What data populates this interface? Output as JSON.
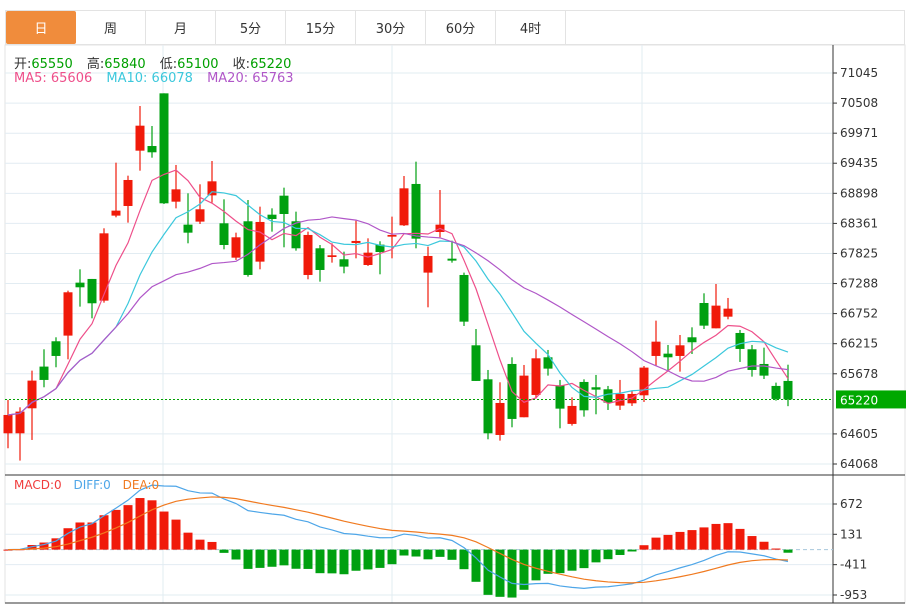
{
  "tabs": [
    "日",
    "周",
    "月",
    "5分",
    "15分",
    "30分",
    "60分",
    "4时"
  ],
  "active_tab": 0,
  "info": {
    "open_label": "开:",
    "open": "65550",
    "high_label": "高:",
    "high": "65840",
    "low_label": "低:",
    "low": "65100",
    "close_label": "收:",
    "close": "65220"
  },
  "ma": {
    "ma5": "MA5: 65606",
    "ma10": "MA10: 66078",
    "ma20": "MA20: 65763"
  },
  "macd": {
    "macd": "MACD:0",
    "diff": "DIFF:0",
    "dea": "DEA:0"
  },
  "colors": {
    "up": "#f01a0a",
    "down": "#00a010",
    "ma5": "#ee4f8a",
    "ma10": "#3cc8dc",
    "ma20": "#b057c8",
    "diff": "#4ea6e8",
    "dea": "#f07a20",
    "active_tab": "#F08C3C"
  },
  "chart_data": {
    "type": "candlestick",
    "price_ticks": [
      "71045",
      "70508",
      "69971",
      "69435",
      "68898",
      "68361",
      "67825",
      "67288",
      "66752",
      "66215",
      "65678",
      "64605",
      "64068"
    ],
    "price_range": [
      64068,
      71045
    ],
    "last_price": "65220",
    "macd_ticks": [
      "672",
      "131",
      "-411",
      "-953"
    ],
    "macd_range": [
      -953,
      672
    ],
    "ohlc": [
      [
        64616,
        65211,
        64349,
        64943
      ],
      [
        64616,
        65080,
        64129,
        65003
      ],
      [
        65062,
        65734,
        64497,
        65556
      ],
      [
        65806,
        66115,
        65437,
        65568
      ],
      [
        66258,
        66329,
        65794,
        65996
      ],
      [
        66359,
        67161,
        65936,
        67132
      ],
      [
        67304,
        67542,
        66876,
        67221
      ],
      [
        67370,
        67370,
        66668,
        66936
      ],
      [
        66983,
        68274,
        66947,
        68184
      ],
      [
        68500,
        69445,
        68470,
        68589
      ],
      [
        68672,
        69213,
        68375,
        69136
      ],
      [
        69659,
        70456,
        69302,
        70105
      ],
      [
        69742,
        70099,
        69534,
        69630
      ],
      [
        70682,
        70682,
        68708,
        68720
      ],
      [
        68749,
        69404,
        68630,
        68969
      ],
      [
        68339,
        68898,
        68006,
        68196
      ],
      [
        68393,
        69059,
        68351,
        68613
      ],
      [
        68862,
        69475,
        68732,
        69112
      ],
      [
        68363,
        68791,
        67899,
        67976
      ],
      [
        67750,
        68196,
        67709,
        68113
      ],
      [
        68399,
        68779,
        67411,
        67441
      ],
      [
        67679,
        68660,
        67542,
        68387
      ],
      [
        68517,
        68630,
        68214,
        68440
      ],
      [
        68856,
        68999,
        67935,
        68529
      ],
      [
        68399,
        68571,
        67875,
        67917
      ],
      [
        67441,
        68214,
        67364,
        68155
      ],
      [
        67917,
        67976,
        67322,
        67530
      ],
      [
        67762,
        68006,
        67661,
        67792
      ],
      [
        67721,
        67857,
        67471,
        67590
      ],
      [
        68012,
        68410,
        67738,
        68048
      ],
      [
        67619,
        68095,
        67602,
        67839
      ],
      [
        67982,
        68042,
        67453,
        67851
      ],
      [
        68125,
        68482,
        67738,
        68155
      ],
      [
        68327,
        69207,
        68315,
        68987
      ],
      [
        69065,
        69463,
        67917,
        68089
      ],
      [
        67483,
        67946,
        66864,
        67780
      ],
      [
        68208,
        68957,
        68113,
        68339
      ],
      [
        67732,
        68053,
        67661,
        67697
      ],
      [
        67441,
        67483,
        66531,
        66608
      ],
      [
        66186,
        66477,
        65550,
        65550
      ],
      [
        65579,
        65746,
        64509,
        64616
      ],
      [
        64586,
        65526,
        64485,
        65157
      ],
      [
        65853,
        65972,
        64723,
        64872
      ],
      [
        64902,
        65835,
        64902,
        65645
      ],
      [
        65300,
        66115,
        65240,
        65954
      ],
      [
        65972,
        66103,
        65645,
        65770
      ],
      [
        65472,
        65568,
        64705,
        65056
      ],
      [
        64783,
        65258,
        64753,
        65104
      ],
      [
        65532,
        65579,
        64913,
        65026
      ],
      [
        65437,
        65657,
        64955,
        65395
      ],
      [
        65401,
        65461,
        65032,
        65163
      ],
      [
        65110,
        65568,
        65032,
        65318
      ],
      [
        65151,
        65377,
        65104,
        65318
      ],
      [
        65294,
        65817,
        65175,
        65788
      ],
      [
        65996,
        66626,
        65817,
        66251
      ],
      [
        66037,
        66192,
        65746,
        65972
      ],
      [
        65996,
        66370,
        65716,
        66186
      ],
      [
        66329,
        66507,
        66031,
        66240
      ],
      [
        66941,
        67114,
        66477,
        66537
      ],
      [
        66489,
        67280,
        66489,
        66894
      ],
      [
        66697,
        67031,
        66650,
        66840
      ],
      [
        66406,
        66460,
        65889,
        66121
      ],
      [
        66115,
        66192,
        65627,
        65746
      ],
      [
        65853,
        66144,
        65585,
        65645
      ],
      [
        65461,
        65520,
        65199,
        65229
      ],
      [
        65550,
        65840,
        65100,
        65220
      ]
    ]
  }
}
